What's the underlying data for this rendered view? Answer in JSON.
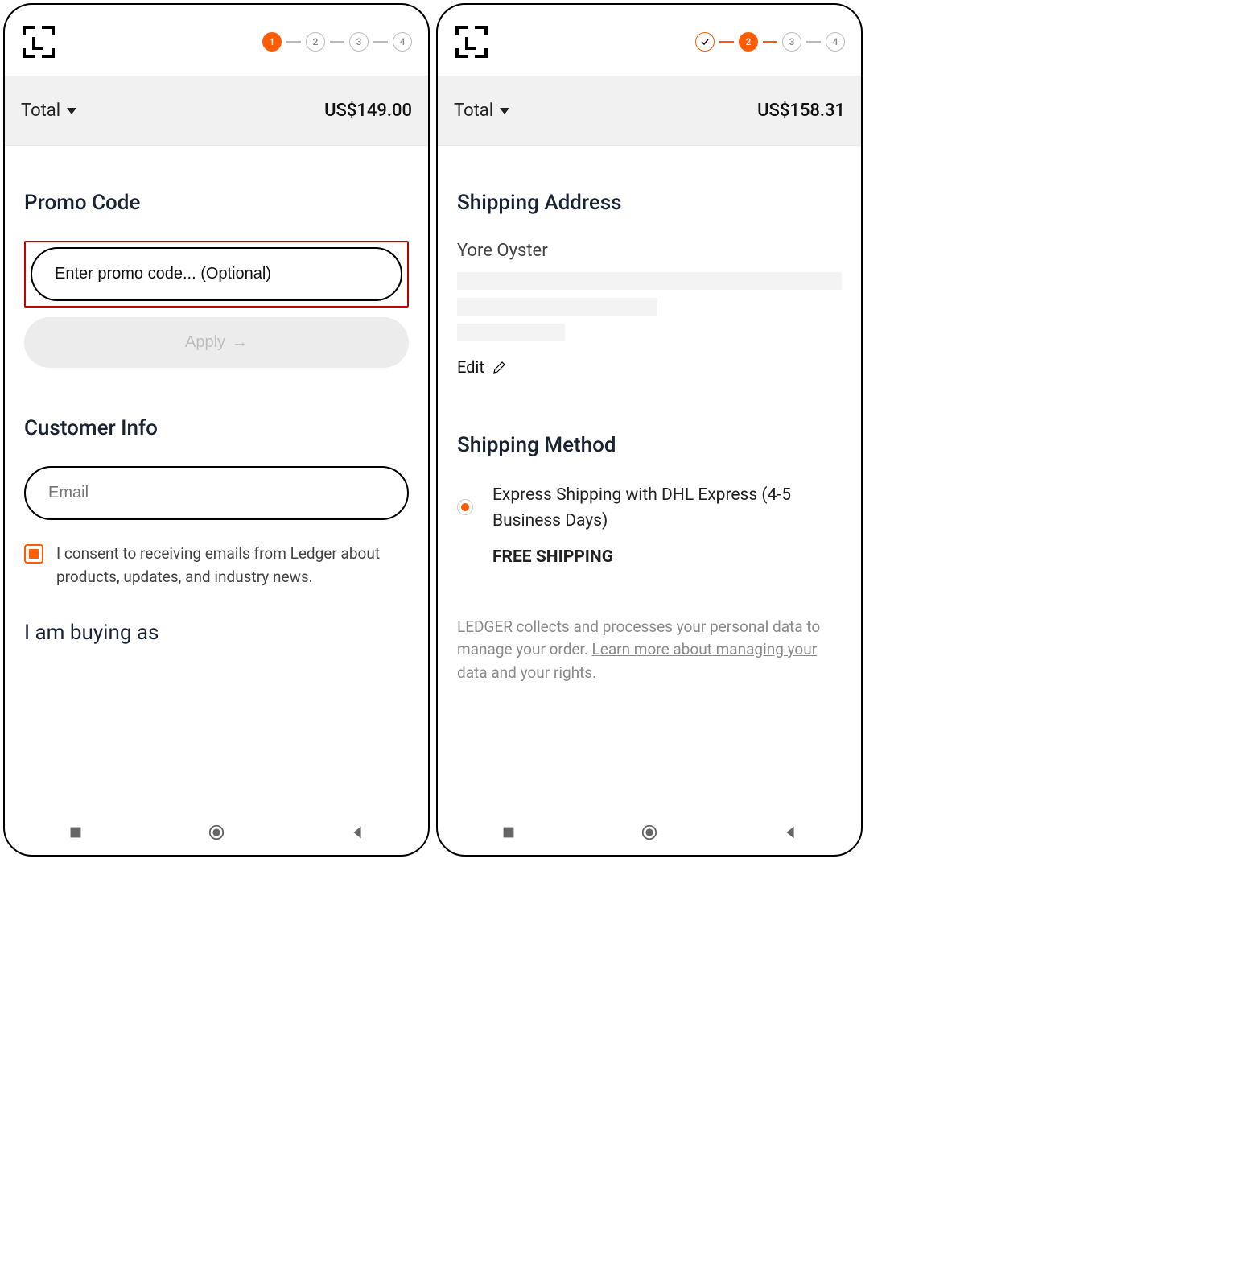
{
  "left": {
    "stepper": {
      "active": 1,
      "steps": [
        "1",
        "2",
        "3",
        "4"
      ]
    },
    "total_label": "Total",
    "total_amount": "US$149.00",
    "promo_title": "Promo Code",
    "promo_placeholder": "Enter promo code... (Optional)",
    "apply_label": "Apply",
    "customer_title": "Customer Info",
    "email_placeholder": "Email",
    "consent_text": "I consent to receiving emails from Ledger about products, updates, and industry news.",
    "buying_title": "I am buying as"
  },
  "right": {
    "stepper": {
      "active": 2,
      "done": 1,
      "steps": [
        "✓",
        "2",
        "3",
        "4"
      ]
    },
    "total_label": "Total",
    "total_amount": "US$158.31",
    "shipping_addr_title": "Shipping Address",
    "addr_name": "Yore Oyster",
    "edit_label": "Edit",
    "shipping_method_title": "Shipping Method",
    "ship_option": "Express Shipping with DHL Express (4-5 Business Days)",
    "ship_price": "FREE SHIPPING",
    "privacy_prefix": "LEDGER collects and processes your personal data to manage your order. ",
    "privacy_link": "Learn more about managing your data and your rights",
    "privacy_suffix": "."
  }
}
